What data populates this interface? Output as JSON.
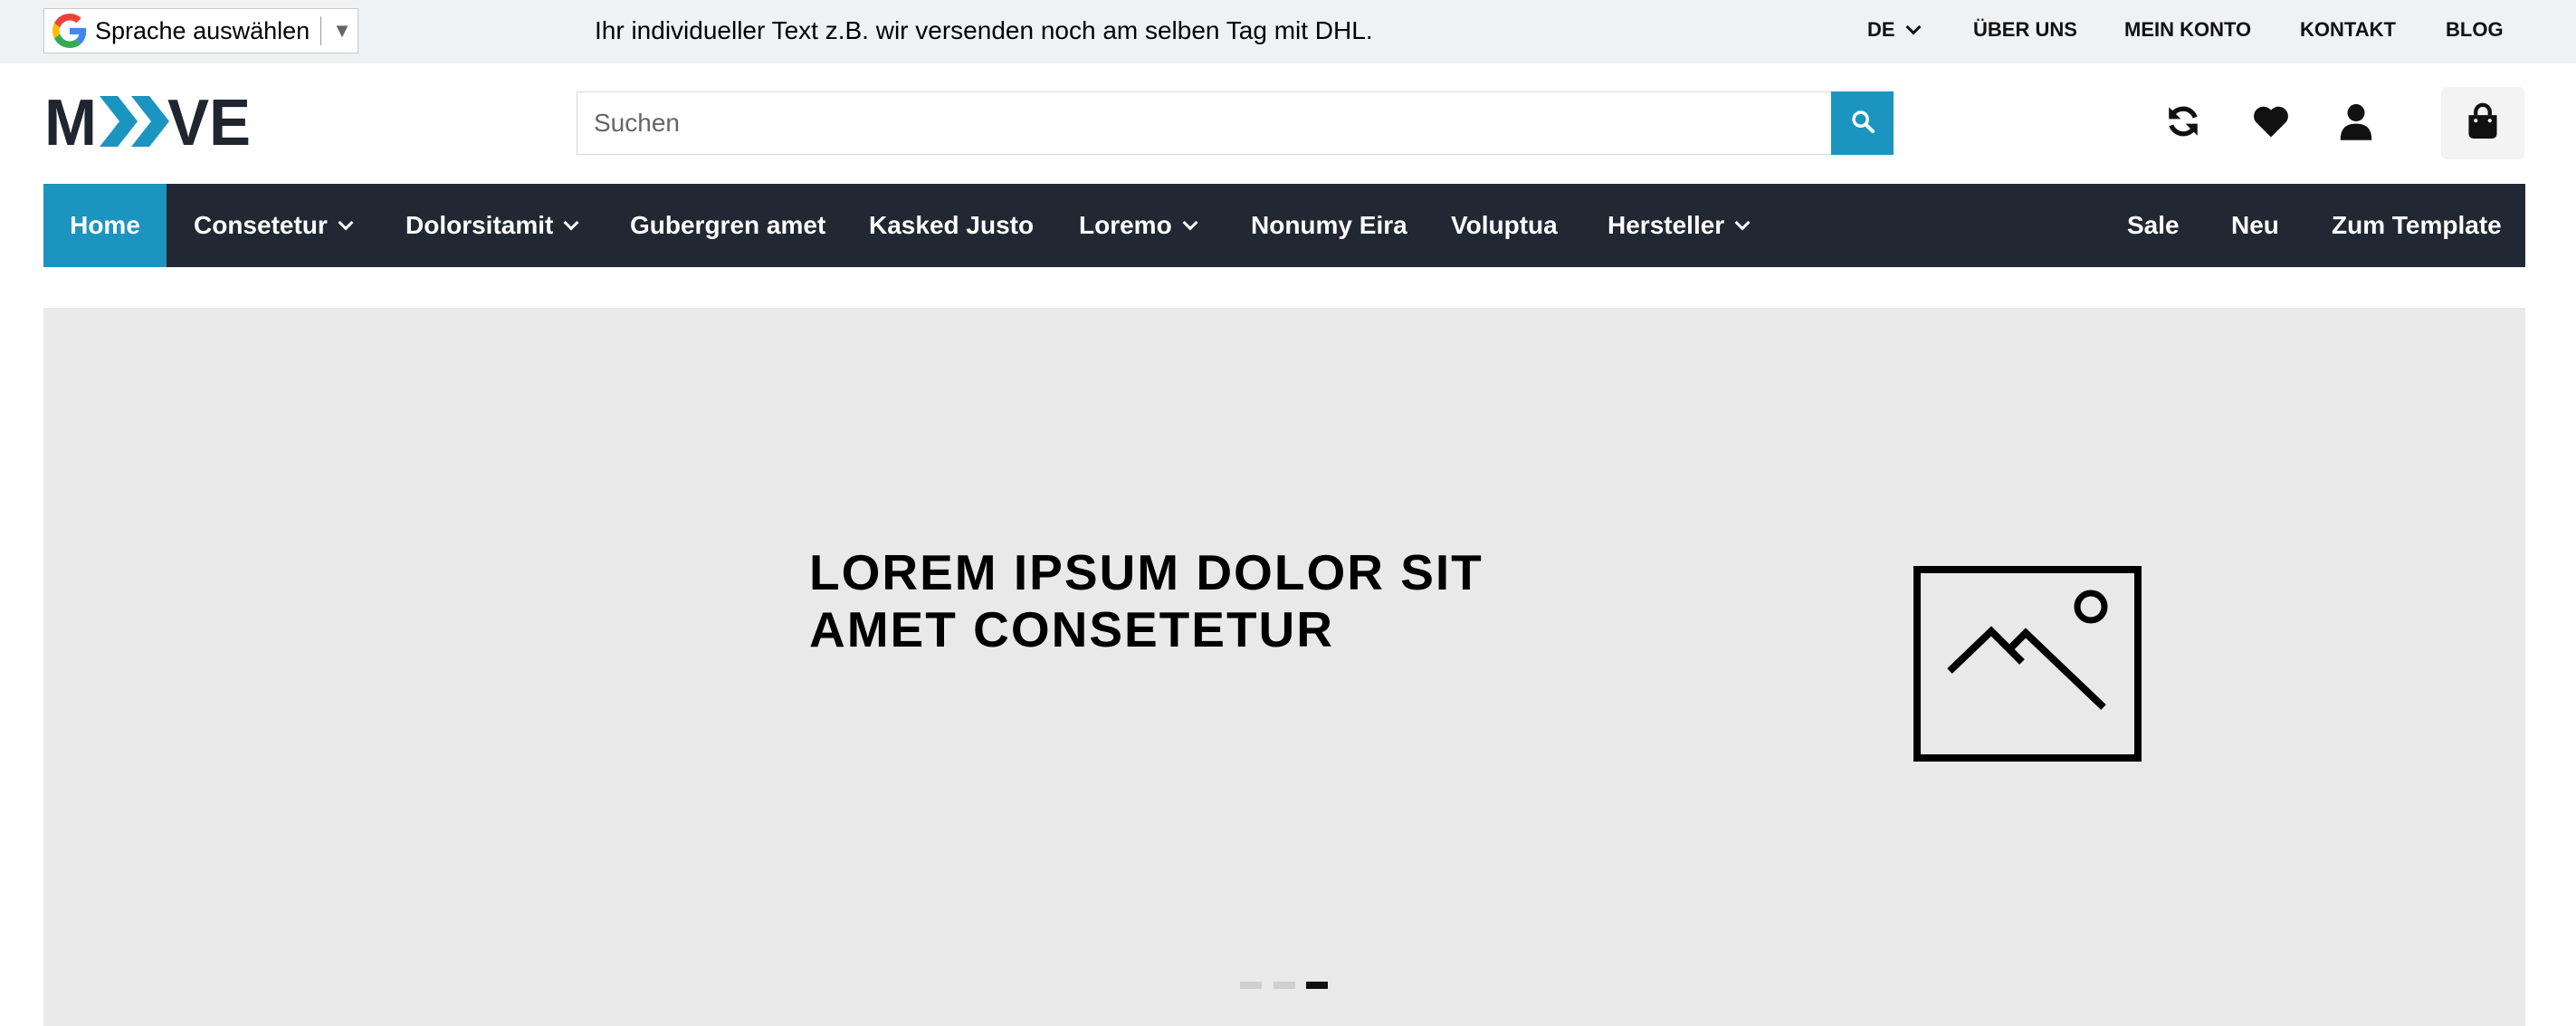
{
  "translate_widget": {
    "label": "Sprache auswählen",
    "arrow": "▼",
    "icon": "google-g-icon"
  },
  "promo_text": "Ihr individueller Text z.B. wir versenden noch am selben Tag mit DHL.",
  "top_nav": {
    "language": "DE",
    "links": [
      "ÜBER UNS",
      "MEIN KONTO",
      "KONTAKT",
      "BLOG"
    ]
  },
  "logo": {
    "text": "MOVE",
    "brand_dark": "#1f2630",
    "brand_accent": "#1b95c0"
  },
  "search": {
    "placeholder": "Suchen",
    "value": "",
    "icon": "search-icon"
  },
  "header_icons": [
    "refresh-icon",
    "heart-icon",
    "user-icon",
    "shopping-bag-icon"
  ],
  "main_nav": {
    "items": [
      {
        "label": "Home",
        "active": true,
        "dropdown": false
      },
      {
        "label": "Consetetur",
        "active": false,
        "dropdown": true
      },
      {
        "label": "Dolorsitamit",
        "active": false,
        "dropdown": true
      },
      {
        "label": "Gubergren amet",
        "active": false,
        "dropdown": false
      },
      {
        "label": "Kasked Justo",
        "active": false,
        "dropdown": false
      },
      {
        "label": "Loremo",
        "active": false,
        "dropdown": true
      },
      {
        "label": "Nonumy Eira",
        "active": false,
        "dropdown": false
      },
      {
        "label": "Voluptua",
        "active": false,
        "dropdown": false
      },
      {
        "label": "Hersteller",
        "active": false,
        "dropdown": true
      }
    ],
    "right_items": [
      "Sale",
      "Neu",
      "Zum Template"
    ]
  },
  "hero": {
    "headline_line1": "LOREM IPSUM DOLOR SIT",
    "headline_line2": "AMET CONSETETUR",
    "image_icon": "image-placeholder-icon",
    "slides": 3,
    "active_slide": 3
  },
  "colors": {
    "nav_bg": "#212833",
    "accent": "#1b95c0",
    "topbar_bg": "#f0f1f3",
    "hero_bg": "#e9e9e9"
  }
}
